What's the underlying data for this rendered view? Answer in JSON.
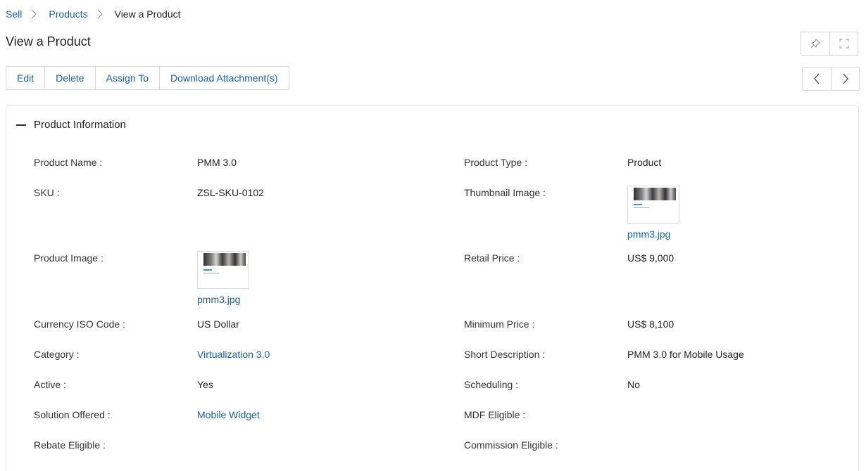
{
  "breadcrumb": {
    "items": [
      "Sell",
      "Products"
    ],
    "current": "View a Product"
  },
  "page_title": "View a Product",
  "actions": {
    "edit": "Edit",
    "delete": "Delete",
    "assign_to": "Assign To",
    "download": "Download Attachment(s)"
  },
  "icons": {
    "pin": "pin-icon",
    "fullscreen": "fullscreen-icon",
    "prev": "chevron-left-icon",
    "next": "chevron-right-icon",
    "collapse": "minus-icon"
  },
  "section": {
    "title": "Product Information",
    "fields": {
      "product_name": {
        "label": "Product Name :",
        "value": "PMM 3.0"
      },
      "product_type": {
        "label": "Product Type :",
        "value": "Product"
      },
      "sku": {
        "label": "SKU :",
        "value": "ZSL-SKU-0102"
      },
      "thumbnail_image": {
        "label": "Thumbnail Image :",
        "file": "pmm3.jpg"
      },
      "product_image": {
        "label": "Product Image :",
        "file": "pmm3.jpg"
      },
      "retail_price": {
        "label": "Retail Price :",
        "value": "US$ 9,000"
      },
      "currency_iso_code": {
        "label": "Currency ISO Code :",
        "value": "US Dollar"
      },
      "minimum_price": {
        "label": "Minimum Price :",
        "value": "US$ 8,100"
      },
      "category": {
        "label": "Category :",
        "value": "Virtualization 3.0"
      },
      "short_description": {
        "label": "Short Description :",
        "value": "PMM 3.0 for Mobile Usage"
      },
      "active": {
        "label": "Active :",
        "value": "Yes"
      },
      "scheduling": {
        "label": "Scheduling :",
        "value": "No"
      },
      "solution_offered": {
        "label": "Solution Offered :",
        "value": "Mobile Widget"
      },
      "mdf_eligible": {
        "label": "MDF Eligible :",
        "value": ""
      },
      "rebate_eligible": {
        "label": "Rebate Eligible :",
        "value": ""
      },
      "commission_eligible": {
        "label": "Commission Eligible :",
        "value": ""
      }
    }
  },
  "colors": {
    "link": "#1a5fa8",
    "text": "#222222",
    "border": "#d6d6d6"
  }
}
